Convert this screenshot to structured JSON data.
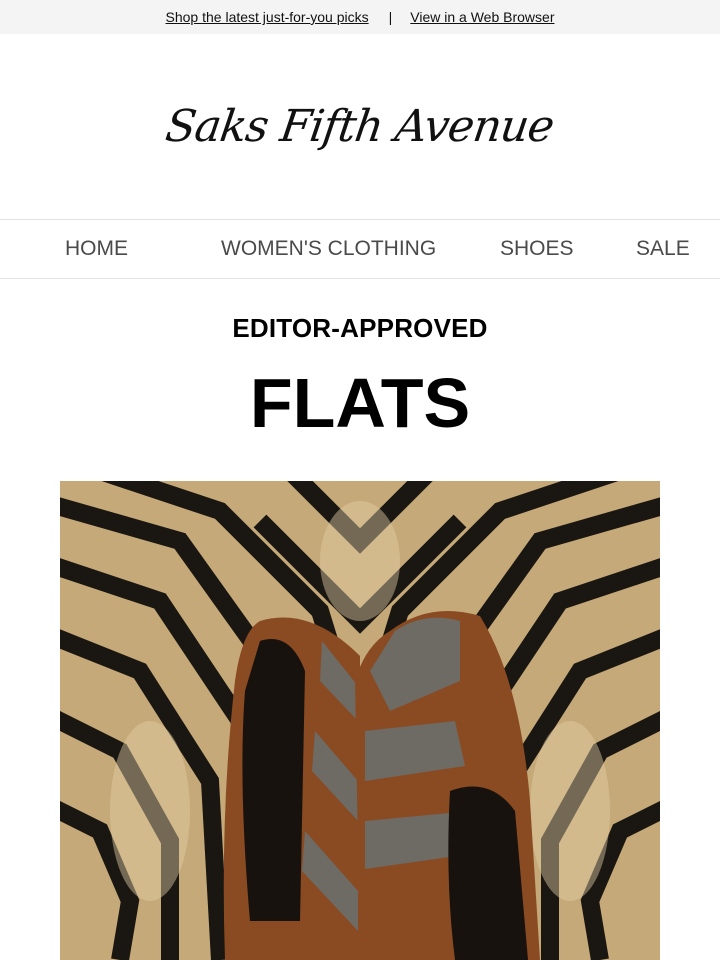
{
  "topbar": {
    "picks_link": "Shop the latest just-for-you picks",
    "separator": "|",
    "browser_link": "View in a Web Browser"
  },
  "brand": {
    "logo_text": "Saks Fifth Avenue"
  },
  "nav": {
    "items": [
      {
        "label": "HOME"
      },
      {
        "label": "WOMEN'S CLOTHING"
      },
      {
        "label": "SHOES"
      },
      {
        "label": "SALE"
      }
    ]
  },
  "hero": {
    "kicker": "EDITOR-APPROVED",
    "headline": "FLATS"
  },
  "colors": {
    "topbar_bg": "#f4f4f4",
    "nav_text": "#4a4a4a",
    "rug_tan": "#c6a978",
    "rug_black": "#1a1712",
    "suede_brown": "#8a4a22",
    "leather_grey": "#6e6a64"
  }
}
